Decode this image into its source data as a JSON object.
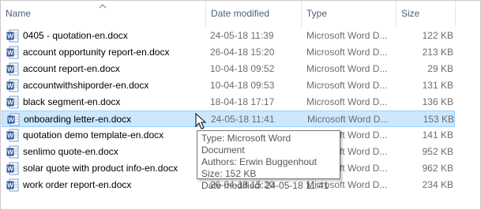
{
  "columns": {
    "name": "Name",
    "date": "Date modified",
    "type": "Type",
    "size": "Size"
  },
  "files": [
    {
      "name": "0405 - quotation-en.docx",
      "date": "24-05-18 11:39",
      "type": "Microsoft Word D...",
      "size": "122 KB"
    },
    {
      "name": "account opportunity report-en.docx",
      "date": "26-04-18 15:20",
      "type": "Microsoft Word D...",
      "size": "213 KB"
    },
    {
      "name": "account report-en.docx",
      "date": "10-04-18 09:52",
      "type": "Microsoft Word D...",
      "size": "29 KB"
    },
    {
      "name": "accountwithshiporder-en.docx",
      "date": "10-04-18 09:53",
      "type": "Microsoft Word D...",
      "size": "131 KB"
    },
    {
      "name": "black segment-en.docx",
      "date": "18-04-18 17:17",
      "type": "Microsoft Word D...",
      "size": "136 KB"
    },
    {
      "name": "onboarding letter-en.docx",
      "date": "24-05-18 11:41",
      "type": "Microsoft Word D...",
      "size": "153 KB"
    },
    {
      "name": "quotation demo template-en.docx",
      "date": "",
      "type": "Microsoft Word D...",
      "size": "141 KB"
    },
    {
      "name": "senlimo quote-en.docx",
      "date": "",
      "type": "Microsoft Word D...",
      "size": "952 KB"
    },
    {
      "name": "solar quote with product info-en.docx",
      "date": "",
      "type": "Microsoft Word D...",
      "size": "962 KB"
    },
    {
      "name": "work order report-en.docx",
      "date": "26-04-18 15:20",
      "type": "Microsoft Word D...",
      "size": "234 KB"
    }
  ],
  "selected_index": 5,
  "tooltip": {
    "type": "Type: Microsoft Word Document",
    "authors": "Authors: Erwin Buggenhout",
    "size": "Size: 152 KB",
    "date": "Date modified: 24-05-18 11:41"
  },
  "colors": {
    "header_text": "#4c607a",
    "selection_bg": "#cce8ff",
    "selection_border": "#99d1ff",
    "word_blue": "#2b579a"
  },
  "icons": {
    "file": "word-document-icon",
    "sort": "sort-ascending-arrow-icon",
    "cursor": "mouse-pointer-icon"
  }
}
